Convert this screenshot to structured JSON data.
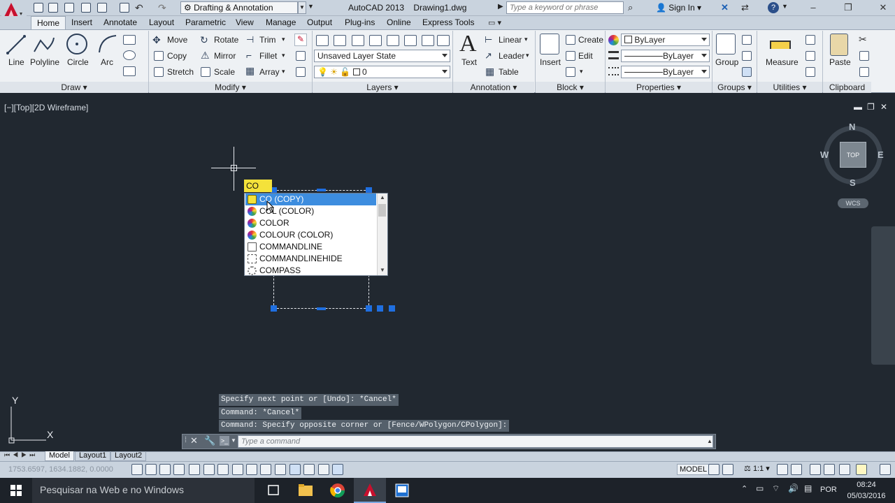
{
  "titlebar": {
    "workspace": "Drafting & Annotation",
    "app_title": "AutoCAD 2013",
    "document": "Drawing1.dwg",
    "search_placeholder": "Type a keyword or phrase",
    "sign_in": "Sign In"
  },
  "tabs": [
    "Home",
    "Insert",
    "Annotate",
    "Layout",
    "Parametric",
    "View",
    "Manage",
    "Output",
    "Plug-ins",
    "Online",
    "Express Tools"
  ],
  "ribbon": {
    "draw": {
      "title": "Draw",
      "line": "Line",
      "polyline": "Polyline",
      "circle": "Circle",
      "arc": "Arc"
    },
    "modify": {
      "title": "Modify",
      "move": "Move",
      "rotate": "Rotate",
      "trim": "Trim",
      "copy": "Copy",
      "mirror": "Mirror",
      "fillet": "Fillet",
      "stretch": "Stretch",
      "scale": "Scale",
      "array": "Array"
    },
    "layers": {
      "title": "Layers",
      "state": "Unsaved Layer State",
      "layer": "0"
    },
    "annotation": {
      "title": "Annotation",
      "text": "Text",
      "linear": "Linear",
      "leader": "Leader",
      "table": "Table"
    },
    "block": {
      "title": "Block",
      "insert": "Insert",
      "create": "Create",
      "edit": "Edit"
    },
    "properties": {
      "title": "Properties",
      "color": "ByLayer",
      "linetype": "ByLayer",
      "lineweight": "ByLayer"
    },
    "groups": {
      "title": "Groups",
      "group": "Group"
    },
    "utilities": {
      "title": "Utilities",
      "measure": "Measure"
    },
    "clipboard": {
      "title": "Clipboard",
      "paste": "Paste"
    }
  },
  "viewport": {
    "label": "[−][Top][2D Wireframe]",
    "viewcube": {
      "top": "TOP",
      "n": "N",
      "s": "S",
      "w": "W",
      "e": "E",
      "wcs": "WCS"
    },
    "ucs": {
      "x": "X",
      "y": "Y"
    }
  },
  "autocomplete": {
    "typed": "CO",
    "items": [
      {
        "label": "CO (COPY)",
        "icon": "copy-icon",
        "color": "#f4e23a"
      },
      {
        "label": "COL (COLOR)",
        "icon": "color-wheel-icon",
        "color": "#e0682a"
      },
      {
        "label": "COLOR",
        "icon": "color-wheel-icon",
        "color": "#e0682a"
      },
      {
        "label": "COLOUR (COLOR)",
        "icon": "color-wheel-icon",
        "color": "#e0682a"
      },
      {
        "label": "COMMANDLINE",
        "icon": "commandline-icon",
        "color": "#7a8696"
      },
      {
        "label": "COMMANDLINEHIDE",
        "icon": "commandline-hide-icon",
        "color": "#7a8696"
      },
      {
        "label": "COMPASS",
        "icon": "compass-gear-icon",
        "color": "#8a8f96"
      }
    ]
  },
  "command": {
    "history": [
      "Specify next point or [Undo]: *Cancel*",
      "Command: *Cancel*",
      "Command: Specify opposite corner or [Fence/WPolygon/CPolygon]:"
    ],
    "placeholder": "Type a command"
  },
  "layout_tabs": [
    "Model",
    "Layout1",
    "Layout2"
  ],
  "status": {
    "coords": "1753.6597, 1634.1882, 0.0000",
    "model": "MODEL",
    "scale": "1:1"
  },
  "taskbar": {
    "search": "Pesquisar na Web e no Windows",
    "lang": "POR",
    "time": "08:24",
    "date": "05/03/2016"
  },
  "colors": {
    "accent": "#1f6fe0",
    "selection": "#3d8ddf",
    "input": "#f4e23a"
  }
}
